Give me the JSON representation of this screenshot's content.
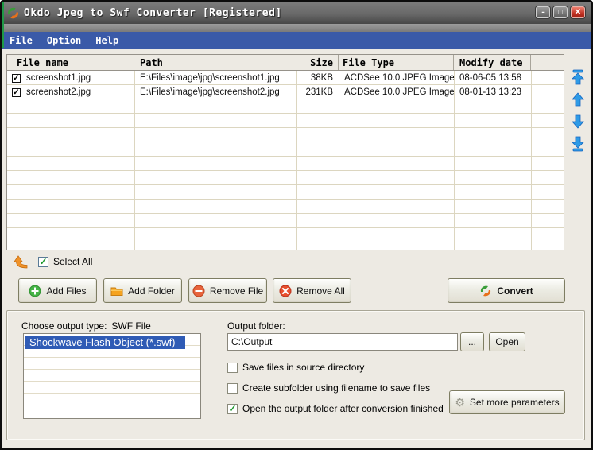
{
  "window": {
    "title": "Okdo Jpeg to Swf Converter [Registered]",
    "controls": {
      "minimize": "-",
      "maximize": "□",
      "close": "✕"
    }
  },
  "menu": {
    "items": [
      "File",
      "Option",
      "Help"
    ]
  },
  "file_table": {
    "columns": [
      "File name",
      "Path",
      "Size",
      "File Type",
      "Modify date"
    ],
    "rows": [
      {
        "checked": true,
        "check_mark": "✓",
        "file_name": "screenshot1.jpg",
        "path": "E:\\Files\\image\\jpg\\screenshot1.jpg",
        "size": "38KB",
        "file_type": "ACDSee 10.0 JPEG Image",
        "modify_date": "08-06-05 13:58"
      },
      {
        "checked": true,
        "check_mark": "✓",
        "file_name": "screenshot2.jpg",
        "path": "E:\\Files\\image\\jpg\\screenshot2.jpg",
        "size": "231KB",
        "file_type": "ACDSee 10.0 JPEG Image",
        "modify_date": "08-01-13 13:23"
      }
    ]
  },
  "reorder": {
    "icons": [
      "move-top-icon",
      "move-up-icon",
      "move-down-icon",
      "move-bottom-icon"
    ]
  },
  "select_all": {
    "label": "Select All",
    "checked": true,
    "check_mark": "✓"
  },
  "toolbar": {
    "add_files": "Add Files",
    "add_folder": "Add Folder",
    "remove_file": "Remove File",
    "remove_all": "Remove All",
    "convert": "Convert"
  },
  "output_panel": {
    "choose_output_label": "Choose output type:",
    "choose_output_value": "SWF File",
    "format_list": [
      {
        "label": "Shockwave Flash Object (*.swf)",
        "selected": true
      }
    ],
    "output_folder_label": "Output folder:",
    "output_folder_value": "C:\\Output",
    "browse_button": "...",
    "open_button": "Open",
    "checkboxes": [
      {
        "label": "Save files in source directory",
        "checked": false,
        "check_mark": "✓"
      },
      {
        "label": "Create subfolder using filename to save files",
        "checked": false,
        "check_mark": "✓"
      },
      {
        "label": "Open the output folder after conversion finished",
        "checked": true,
        "check_mark": "✓"
      }
    ],
    "set_more_parameters": "Set more parameters",
    "gear_glyph": "⚙"
  },
  "colors": {
    "menu_blue": "#3A5AA8",
    "client_bg": "#EDEAE3",
    "selection_blue": "#2F5BB5",
    "grid_line": "#DCD6C0",
    "green_accent": "#1E9A46",
    "close_red": "#C03022"
  }
}
